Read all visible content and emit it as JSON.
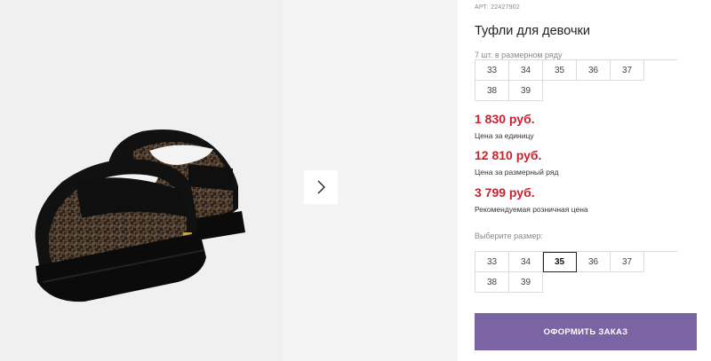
{
  "product": {
    "article": "АРТ: 22427902",
    "title": "Туфли для девочки",
    "size_note": "7 шт. в размерном ряду",
    "sizes_row": [
      "33",
      "34",
      "35",
      "36",
      "37",
      "38",
      "39"
    ],
    "prices": [
      {
        "value": "1 830 руб.",
        "label": "Цена за единицу"
      },
      {
        "value": "12 810 руб.",
        "label": "Цена за размерный ряд"
      },
      {
        "value": "3 799 руб.",
        "label": "Рекомендуемая розничная цена"
      }
    ],
    "choose_size_label": "Выберите размер:",
    "choose_sizes": [
      "33",
      "34",
      "35",
      "36",
      "37",
      "38",
      "39"
    ],
    "selected_size": "35",
    "order_button": "ОФОРМИТЬ ЗАКАЗ"
  },
  "gallery": {
    "image_subject": "black loafers with monogram pattern",
    "next_icon": "chevron-right-icon"
  },
  "colors": {
    "price": "#cc1f2f",
    "button": "#7a64a3",
    "photo_bg": "#f0f0f0"
  }
}
